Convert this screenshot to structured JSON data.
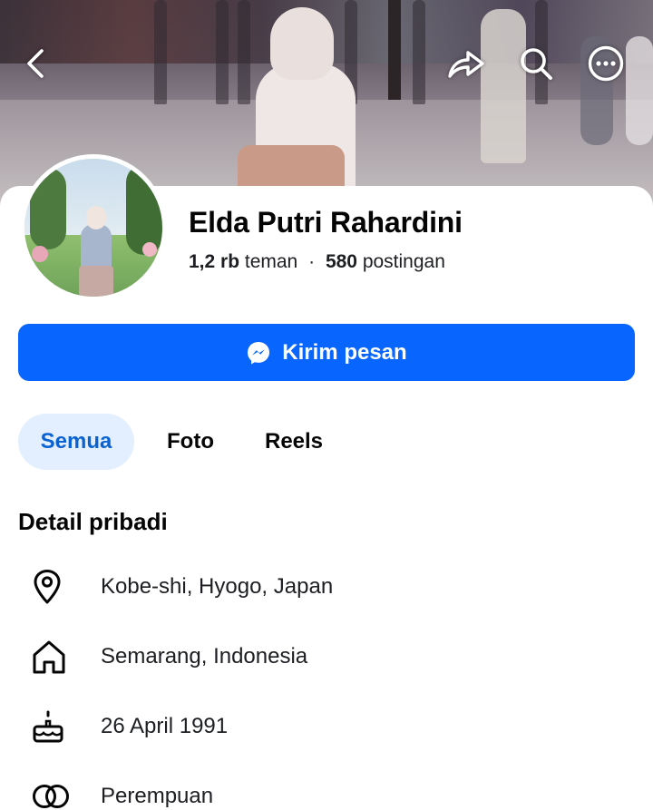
{
  "cover": {
    "top_icons": [
      "back-icon",
      "share-icon",
      "search-icon",
      "more-icon"
    ]
  },
  "profile": {
    "name": "Elda Putri Rahardini",
    "friends_count": "1,2 rb",
    "friends_label": "teman",
    "separator": "·",
    "posts_count": "580",
    "posts_label": "postingan"
  },
  "actions": {
    "message_label": "Kirim pesan",
    "message_icon": "messenger-icon",
    "accent_color": "#0866ff"
  },
  "tabs": [
    {
      "label": "Semua",
      "active": true
    },
    {
      "label": "Foto",
      "active": false
    },
    {
      "label": "Reels",
      "active": false
    }
  ],
  "details": {
    "title": "Detail pribadi",
    "items": [
      {
        "icon": "location-pin-icon",
        "text": "Kobe-shi, Hyogo, Japan"
      },
      {
        "icon": "home-icon",
        "text": "Semarang, Indonesia"
      },
      {
        "icon": "birthday-cake-icon",
        "text": "26 April 1991"
      },
      {
        "icon": "gender-icon",
        "text": "Perempuan"
      }
    ]
  }
}
